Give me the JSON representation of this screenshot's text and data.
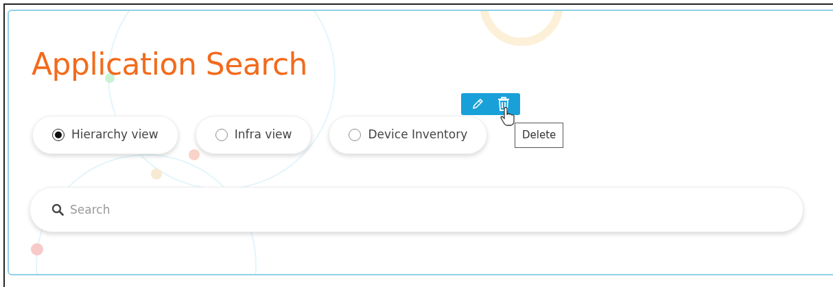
{
  "title": "Application Search",
  "view_options": [
    {
      "label": "Hierarchy view",
      "selected": true
    },
    {
      "label": "Infra view",
      "selected": false
    },
    {
      "label": "Device Inventory",
      "selected": false
    }
  ],
  "toolbar": [
    {
      "kind": "edit"
    },
    {
      "kind": "delete"
    }
  ],
  "tooltip": {
    "text": "Delete"
  },
  "search": {
    "placeholder": "Search"
  }
}
